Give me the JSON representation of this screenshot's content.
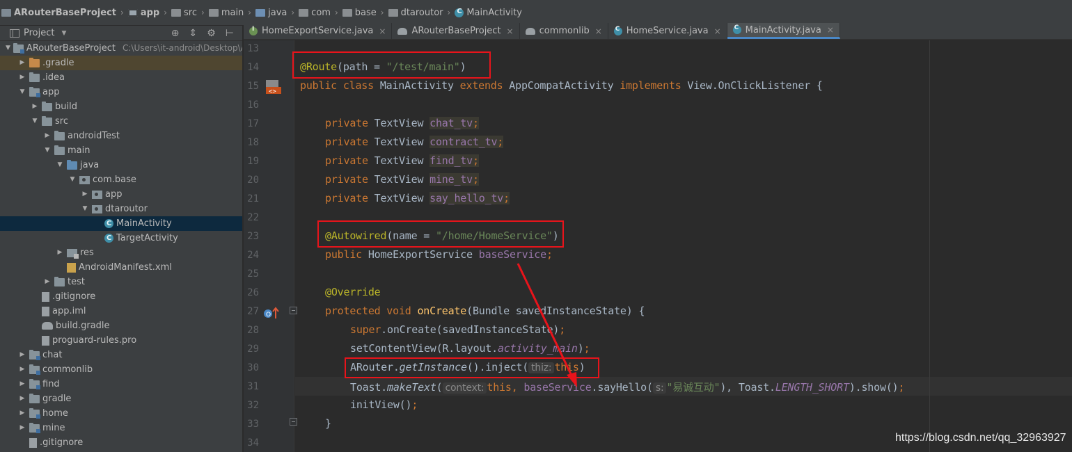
{
  "breadcrumb": {
    "items": [
      {
        "label": "ARouterBaseProject",
        "icon": "project-icon"
      },
      {
        "label": "app",
        "icon": "module-icon"
      },
      {
        "label": "src",
        "icon": "folder-icon"
      },
      {
        "label": "main",
        "icon": "folder-icon"
      },
      {
        "label": "java",
        "icon": "source-folder-icon"
      },
      {
        "label": "com",
        "icon": "package-icon"
      },
      {
        "label": "base",
        "icon": "package-icon"
      },
      {
        "label": "dtaroutor",
        "icon": "package-icon"
      },
      {
        "label": "MainActivity",
        "icon": "class-icon"
      }
    ]
  },
  "project_panel": {
    "title": "Project",
    "tree": [
      {
        "label": "ARouterBaseProject",
        "hint": "C:\\Users\\it-android\\Desktop\\A",
        "depth": 0,
        "expanded": true,
        "icon": "module"
      },
      {
        "label": ".gradle",
        "depth": 1,
        "expanded": false,
        "icon": "folder-orange",
        "highlight": true
      },
      {
        "label": ".idea",
        "depth": 1,
        "expanded": false,
        "icon": "folder"
      },
      {
        "label": "app",
        "depth": 1,
        "expanded": true,
        "icon": "module"
      },
      {
        "label": "build",
        "depth": 2,
        "expanded": false,
        "icon": "folder"
      },
      {
        "label": "src",
        "depth": 2,
        "expanded": true,
        "icon": "folder"
      },
      {
        "label": "androidTest",
        "depth": 3,
        "expanded": false,
        "icon": "folder"
      },
      {
        "label": "main",
        "depth": 3,
        "expanded": true,
        "icon": "folder"
      },
      {
        "label": "java",
        "depth": 4,
        "expanded": true,
        "icon": "folder-blue"
      },
      {
        "label": "com.base",
        "depth": 5,
        "expanded": true,
        "icon": "pkg"
      },
      {
        "label": "app",
        "depth": 6,
        "expanded": false,
        "icon": "pkg"
      },
      {
        "label": "dtaroutor",
        "depth": 6,
        "expanded": true,
        "icon": "pkg"
      },
      {
        "label": "MainActivity",
        "depth": 7,
        "icon": "class",
        "selected": true
      },
      {
        "label": "TargetActivity",
        "depth": 7,
        "icon": "class"
      },
      {
        "label": "res",
        "depth": 4,
        "expanded": false,
        "icon": "res"
      },
      {
        "label": "AndroidManifest.xml",
        "depth": 4,
        "icon": "xml"
      },
      {
        "label": "test",
        "depth": 3,
        "expanded": false,
        "icon": "folder"
      },
      {
        "label": ".gitignore",
        "depth": 2,
        "icon": "file"
      },
      {
        "label": "app.iml",
        "depth": 2,
        "icon": "file"
      },
      {
        "label": "build.gradle",
        "depth": 2,
        "icon": "elephant"
      },
      {
        "label": "proguard-rules.pro",
        "depth": 2,
        "icon": "file"
      },
      {
        "label": "chat",
        "depth": 1,
        "expanded": false,
        "icon": "module"
      },
      {
        "label": "commonlib",
        "depth": 1,
        "expanded": false,
        "icon": "module"
      },
      {
        "label": "find",
        "depth": 1,
        "expanded": false,
        "icon": "module"
      },
      {
        "label": "gradle",
        "depth": 1,
        "expanded": false,
        "icon": "folder"
      },
      {
        "label": "home",
        "depth": 1,
        "expanded": false,
        "icon": "module"
      },
      {
        "label": "mine",
        "depth": 1,
        "expanded": false,
        "icon": "module"
      },
      {
        "label": ".gitignore",
        "depth": 1,
        "icon": "file"
      }
    ]
  },
  "tabs": [
    {
      "label": "HomeExportService.java",
      "icon": "interface",
      "active": false
    },
    {
      "label": "ARouterBaseProject",
      "icon": "gradle",
      "active": false
    },
    {
      "label": "commonlib",
      "icon": "gradle",
      "active": false
    },
    {
      "label": "HomeService.java",
      "icon": "class",
      "active": false
    },
    {
      "label": "MainActivity.java",
      "icon": "class",
      "active": true
    }
  ],
  "editor": {
    "line_numbers": [
      "13",
      "14",
      "15",
      "16",
      "17",
      "18",
      "19",
      "20",
      "21",
      "22",
      "23",
      "24",
      "25",
      "26",
      "27",
      "28",
      "29",
      "30",
      "31",
      "32",
      "33",
      "34"
    ],
    "code": {
      "l14_ann": "@Route",
      "l14_a": "(path = ",
      "l14_str": "\"/test/main\"",
      "l14_b": ")",
      "l15_kw1": "public class ",
      "l15_a": "MainActivity ",
      "l15_kw2": "extends ",
      "l15_b": "AppCompatActivity ",
      "l15_kw3": "implements ",
      "l15_c": "View.OnClickListener {",
      "private_kw": "private ",
      "textview": "TextView ",
      "fields": [
        "chat_tv",
        "contract_tv",
        "find_tv",
        "mine_tv",
        "say_hello_tv"
      ],
      "semicolon": ";",
      "l23_ann": "@Autowired",
      "l23_a": "(name = ",
      "l23_str": "\"/home/HomeService\"",
      "l23_b": ")",
      "l24_kw": "public ",
      "l24_a": "HomeExportService ",
      "l24_fld": "baseService",
      "l26_ann": "@Override",
      "l27_kw": "protected void ",
      "l27_fn": "onCreate",
      "l27_a": "(Bundle savedInstanceState) {",
      "l28_kw": "super",
      "l28_a": ".onCreate(savedInstanceState)",
      "l29_a": "setContentView(R.layout.",
      "l29_fld": "activity_main",
      "l29_b": ")",
      "l30_a": "ARouter.",
      "l30_fn": "getInstance",
      "l30_b": "().inject(",
      "l30_hint": "thiz:",
      "l30_kw": "this",
      "l30_c": ")",
      "l31_a": "Toast.",
      "l31_fn": "makeText",
      "l31_b": "(",
      "l31_hint1": "context:",
      "l31_kw": "this",
      "l31_comma": ", ",
      "l31_fld": "baseService",
      "l31_c": ".sayHello(",
      "l31_hint2": "s:",
      "l31_str": "\"易诚互动\"",
      "l31_d": "), Toast.",
      "l31_const": "LENGTH_SHORT",
      "l31_e": ").show()",
      "l32_a": "initView()",
      "l33_a": "}"
    }
  },
  "watermark": "https://blog.csdn.net/qq_32963927",
  "colors": {
    "annotation_box": "#e8141b",
    "keyword": "#cc7832",
    "annotation": "#bbb529",
    "string": "#6a8759",
    "field": "#9876aa",
    "method_decl": "#ffc66d",
    "selection": "#0d293e"
  }
}
